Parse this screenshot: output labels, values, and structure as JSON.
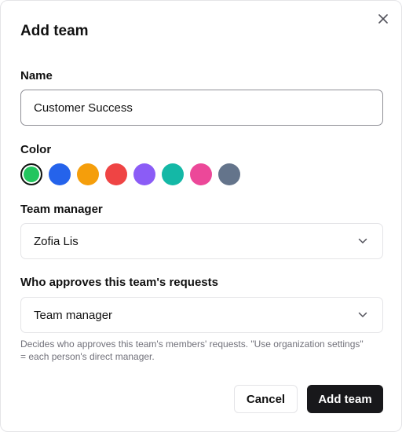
{
  "dialog": {
    "title": "Add team",
    "close_icon": "close-icon"
  },
  "name_field": {
    "label": "Name",
    "value": "Customer Success"
  },
  "color_field": {
    "label": "Color",
    "swatches": [
      {
        "color": "#22c55e",
        "selected": true
      },
      {
        "color": "#2563eb",
        "selected": false
      },
      {
        "color": "#f59e0b",
        "selected": false
      },
      {
        "color": "#ef4444",
        "selected": false
      },
      {
        "color": "#8b5cf6",
        "selected": false
      },
      {
        "color": "#14b8a6",
        "selected": false
      },
      {
        "color": "#ec4899",
        "selected": false
      },
      {
        "color": "#64748b",
        "selected": false
      }
    ]
  },
  "manager_field": {
    "label": "Team manager",
    "value": "Zofia Lis",
    "icon": "chevron-down-icon"
  },
  "approver_field": {
    "label": "Who approves this team's requests",
    "value": "Team manager",
    "icon": "chevron-down-icon",
    "help": "Decides who approves this team's members' requests. \"Use organization settings\" = each person's direct manager."
  },
  "actions": {
    "cancel_label": "Cancel",
    "submit_label": "Add team"
  }
}
